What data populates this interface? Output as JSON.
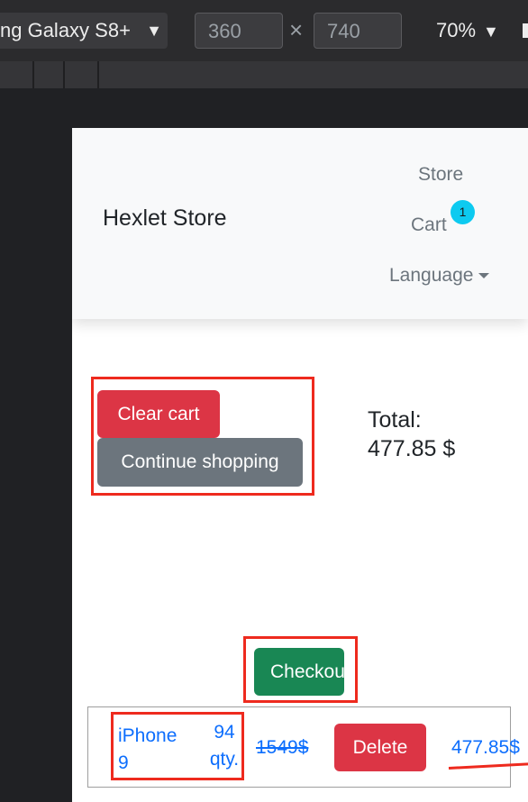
{
  "devtools": {
    "device_name": "ng Galaxy S8+",
    "width": "360",
    "times": "×",
    "height": "740",
    "zoom": "70%",
    "dropdown_arrow": "▼"
  },
  "navbar": {
    "brand": "Hexlet Store",
    "links": {
      "store": "Store",
      "cart": "Cart",
      "language": "Language"
    },
    "cart_badge": "1"
  },
  "actions": {
    "clear_cart": "Clear cart",
    "continue_shopping": "Continue shopping",
    "checkout": "Checkout"
  },
  "summary": {
    "total_label": "Total:",
    "total_value": "477.85 $"
  },
  "cart_items": [
    {
      "name": "iPhone 9",
      "quantity": "94 qty.",
      "old_price": "1549$",
      "delete_label": "Delete",
      "price": "477.85$"
    }
  ],
  "colors": {
    "danger": "#dc3545",
    "secondary": "#6c757d",
    "success": "#198754",
    "link": "#0d6efd",
    "badge": "#0dcaf0",
    "annotation": "#ee2a1e"
  },
  "icons": {
    "device_dropdown": "chevron-down-icon",
    "zoom_dropdown": "chevron-down-icon",
    "language_caret": "caret-down-icon"
  }
}
